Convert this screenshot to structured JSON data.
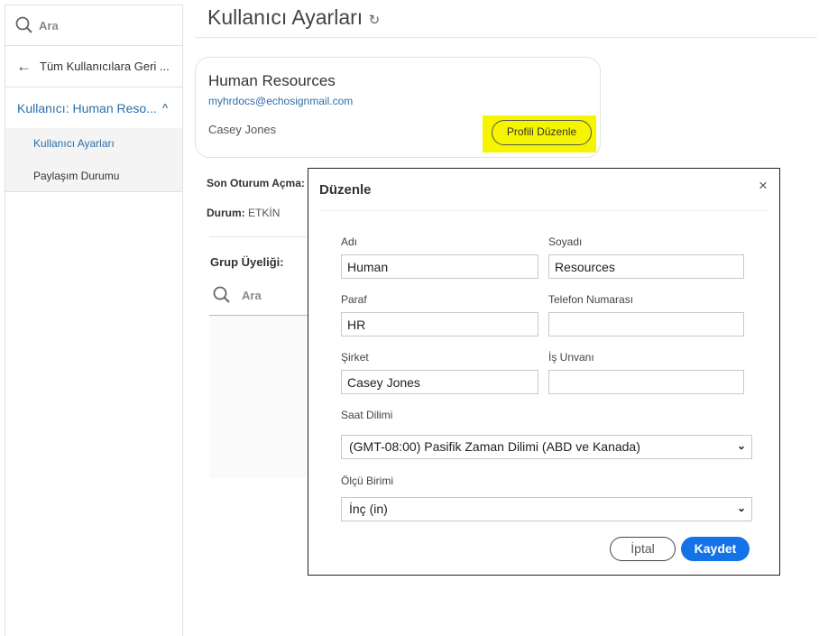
{
  "sidebar": {
    "search_placeholder": "Ara",
    "back_label": "Tüm Kullanıcılara Geri ...",
    "user_label": "Kullanıcı: Human Reso...",
    "items": [
      {
        "label": "Kullanıcı Ayarları"
      },
      {
        "label": "Paylaşım Durumu"
      }
    ]
  },
  "header": {
    "title": "Kullanıcı Ayarları"
  },
  "card": {
    "name": "Human Resources",
    "email": "myhrdocs@echosignmail.com",
    "company": "Casey Jones",
    "edit_button": "Profili Düzenle"
  },
  "info": {
    "last_login_label": "Son Oturum Açma:",
    "status_label": "Durum:",
    "status_value": "ETKİN",
    "group_label": "Grup Üyeliği:",
    "group_search_placeholder": "Ara"
  },
  "modal": {
    "title": "Düzenle",
    "close": "×",
    "fields": {
      "first_name": {
        "label": "Adı",
        "value": "Human"
      },
      "last_name": {
        "label": "Soyadı",
        "value": "Resources"
      },
      "initials": {
        "label": "Paraf",
        "value": "HR"
      },
      "phone": {
        "label": "Telefon Numarası",
        "value": ""
      },
      "company": {
        "label": "Şirket",
        "value": "Casey Jones"
      },
      "title": {
        "label": "İş Unvanı",
        "value": ""
      }
    },
    "timezone": {
      "label": "Saat Dilimi",
      "value": "(GMT-08:00) Pasifik Zaman Dilimi (ABD ve Kanada)"
    },
    "unit": {
      "label": "Ölçü Birimi",
      "value": "İnç (in)"
    },
    "cancel": "İptal",
    "save": "Kaydet"
  },
  "colors": {
    "accent": "#1473e6",
    "link": "#2d6fa8",
    "highlight": "#f5f500"
  }
}
